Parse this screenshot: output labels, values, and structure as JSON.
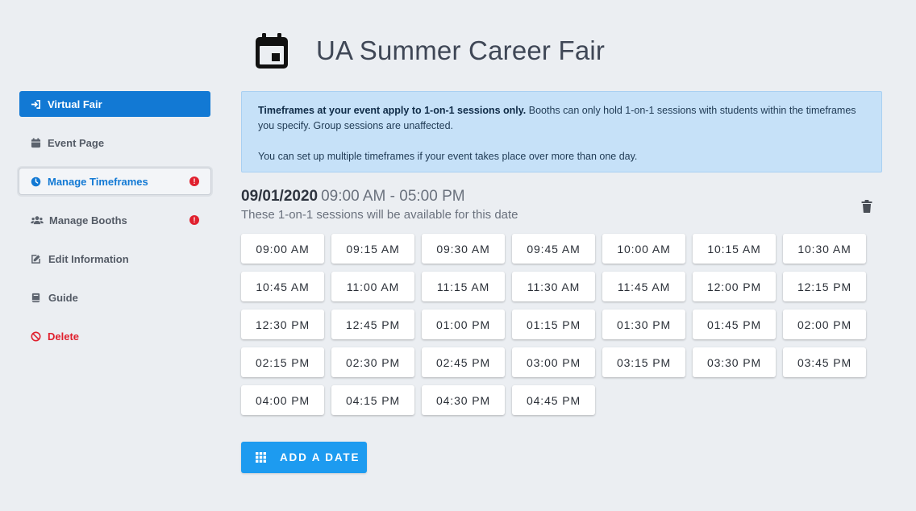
{
  "header": {
    "title": "UA Summer Career Fair",
    "icon": "calendar-icon"
  },
  "sidebar": {
    "items": [
      {
        "label": "Virtual Fair",
        "icon": "sign-in-icon",
        "state": "active"
      },
      {
        "label": "Event Page",
        "icon": "calendar-small-icon",
        "state": "normal"
      },
      {
        "label": "Manage Timeframes",
        "icon": "clock-icon",
        "state": "selected",
        "alert": "!"
      },
      {
        "label": "Manage Booths",
        "icon": "users-icon",
        "state": "normal",
        "alert": "!"
      },
      {
        "label": "Edit Information",
        "icon": "edit-icon",
        "state": "normal"
      },
      {
        "label": "Guide",
        "icon": "book-icon",
        "state": "normal"
      },
      {
        "label": "Delete",
        "icon": "ban-icon",
        "state": "danger"
      }
    ]
  },
  "info": {
    "bold": "Timeframes at your event apply to 1-on-1 sessions only.",
    "text": " Booths can only hold 1-on-1 sessions with students within the timeframes you specify. Group sessions are unaffected.",
    "text2": "You can set up multiple timeframes if your event takes place over more than one day."
  },
  "date_block": {
    "date": "09/01/2020",
    "time_range": "09:00 AM - 05:00 PM",
    "subtitle": "These 1-on-1 sessions will be available for this date",
    "slots": [
      "09:00 AM",
      "09:15 AM",
      "09:30 AM",
      "09:45 AM",
      "10:00 AM",
      "10:15 AM",
      "10:30 AM",
      "10:45 AM",
      "11:00 AM",
      "11:15 AM",
      "11:30 AM",
      "11:45 AM",
      "12:00 PM",
      "12:15 PM",
      "12:30 PM",
      "12:45 PM",
      "01:00 PM",
      "01:15 PM",
      "01:30 PM",
      "01:45 PM",
      "02:00 PM",
      "02:15 PM",
      "02:30 PM",
      "02:45 PM",
      "03:00 PM",
      "03:15 PM",
      "03:30 PM",
      "03:45 PM",
      "04:00 PM",
      "04:15 PM",
      "04:30 PM",
      "04:45 PM"
    ]
  },
  "add_button": {
    "label": "ADD A DATE",
    "icon": "grid-icon"
  },
  "colors": {
    "background": "#ebeef2",
    "primary": "#1279d4",
    "button": "#1d9bf0",
    "danger": "#e0202e",
    "info_bg": "#c6e1f8"
  }
}
